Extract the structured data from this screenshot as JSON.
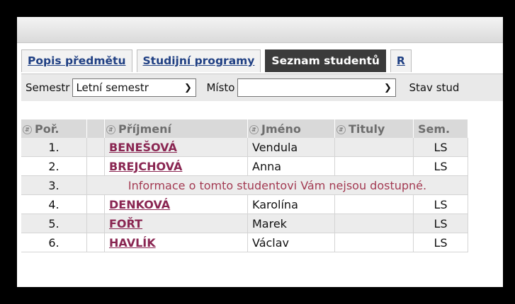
{
  "tabs": [
    {
      "label": "Popis předmětu",
      "active": false
    },
    {
      "label": "Studijní programy",
      "active": false
    },
    {
      "label": "Seznam studentů",
      "active": true
    },
    {
      "label": "R",
      "active": false
    }
  ],
  "filter": {
    "semestr_label": "Semestr",
    "semestr_value": "Letní semestr",
    "misto_label": "Místo",
    "misto_value": "",
    "stav_label": "Stav stud"
  },
  "table": {
    "headers": {
      "por": "Poř.",
      "prijmeni": "Příjmení",
      "jmeno": "Jméno",
      "tituly": "Tituly",
      "sem": "Sem."
    },
    "rows": [
      {
        "por": "1.",
        "prijmeni": "BENEŠOVÁ",
        "jmeno": "Vendula",
        "tituly": "",
        "sem": "LS"
      },
      {
        "por": "2.",
        "prijmeni": "BREJCHOVÁ",
        "jmeno": "Anna",
        "tituly": "",
        "sem": "LS"
      },
      {
        "por": "3.",
        "message": "Informace o tomto studentovi Vám nejsou dostupné."
      },
      {
        "por": "4.",
        "prijmeni": "DENKOVÁ",
        "jmeno": "Karolína",
        "tituly": "",
        "sem": "LS"
      },
      {
        "por": "5.",
        "prijmeni": "FOŘT",
        "jmeno": "Marek",
        "tituly": "",
        "sem": "LS"
      },
      {
        "por": "6.",
        "prijmeni": "HAVLÍK",
        "jmeno": "Václav",
        "tituly": "",
        "sem": "LS"
      }
    ]
  }
}
